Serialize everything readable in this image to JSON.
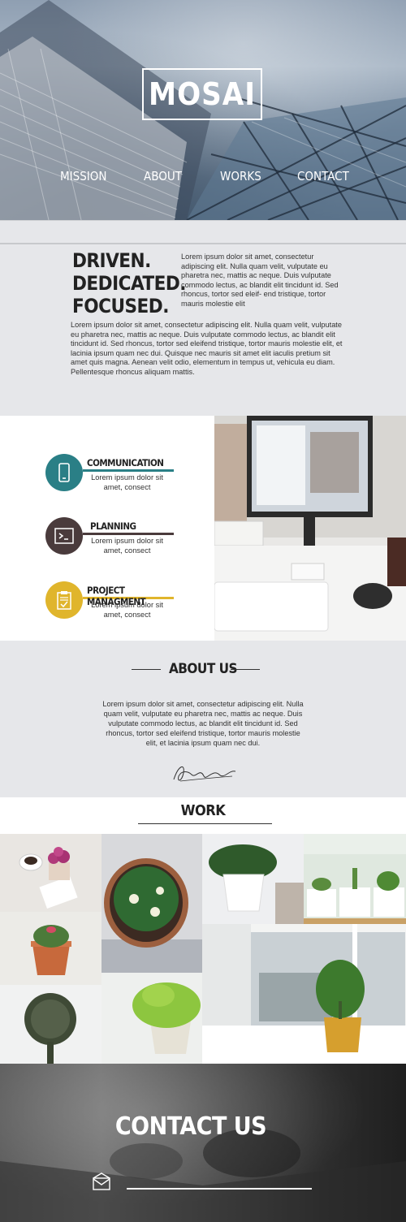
{
  "brand": {
    "logo": "MOSAI"
  },
  "nav": {
    "items": [
      "MISSION",
      "ABOUT",
      "WORKS",
      "CONTACT"
    ]
  },
  "intro": {
    "heading": [
      "DRIVEN.",
      "DEDICATED.",
      "FOCUSED."
    ],
    "paragraph_short": "Lorem ipsum dolor sit amet, consectetur adipiscing elit. Nulla quam velit, vulputate eu pharetra nec, mattis ac neque. Duis vulputate commodo lectus, ac blandit elit tincidunt id. Sed rhoncus, tortor sed eleif- end tristique, tortor mauris molestie elit",
    "paragraph_long": "Lorem ipsum dolor sit amet, consectetur adipiscing elit. Nulla quam velit, vulputate eu pharetra nec, mattis ac neque. Duis vulputate commodo lectus, ac blandit elit tincidunt id. Sed rhoncus, tortor sed eleifend tristique, tortor mauris molestie elit, et lacinia ipsum quam nec dui. Quisque nec mauris sit amet elit iaculis pretium sit amet quis magna. Aenean velit odio, elementum in tempus ut, vehicula eu diam. Pellentesque rhoncus aliquam mattis."
  },
  "services": [
    {
      "title": "COMMUNICATION",
      "desc": "Lorem ipsum dolor sit amet, consect",
      "color": "#2a7f86",
      "icon": "phone-icon"
    },
    {
      "title": "PLANNING",
      "desc": "Lorem ipsum dolor sit amet, consect",
      "color": "#4a3b3c",
      "icon": "terminal-icon"
    },
    {
      "title": "PROJECT MANAGMENT",
      "desc": "Lorem ipsum dolor sit amet, consect",
      "color": "#e0b52c",
      "icon": "clipboard-icon"
    }
  ],
  "about": {
    "title": "ABOUT US",
    "text": "Lorem ipsum dolor sit amet, consectetur adipiscing elit. Nulla quam velit, vulputate eu pharetra nec, mattis ac neque. Duis vulputate commodo lectus, ac blandit elit tincidunt id. Sed rhoncus, tortor sed eleifend tristique, tortor mauris molestie elit, et lacinia ipsum quam nec dui.",
    "signature": "signature-image"
  },
  "work": {
    "title": "WORK"
  },
  "contact": {
    "title": "CONTACT US",
    "icon": "mail-icon"
  }
}
